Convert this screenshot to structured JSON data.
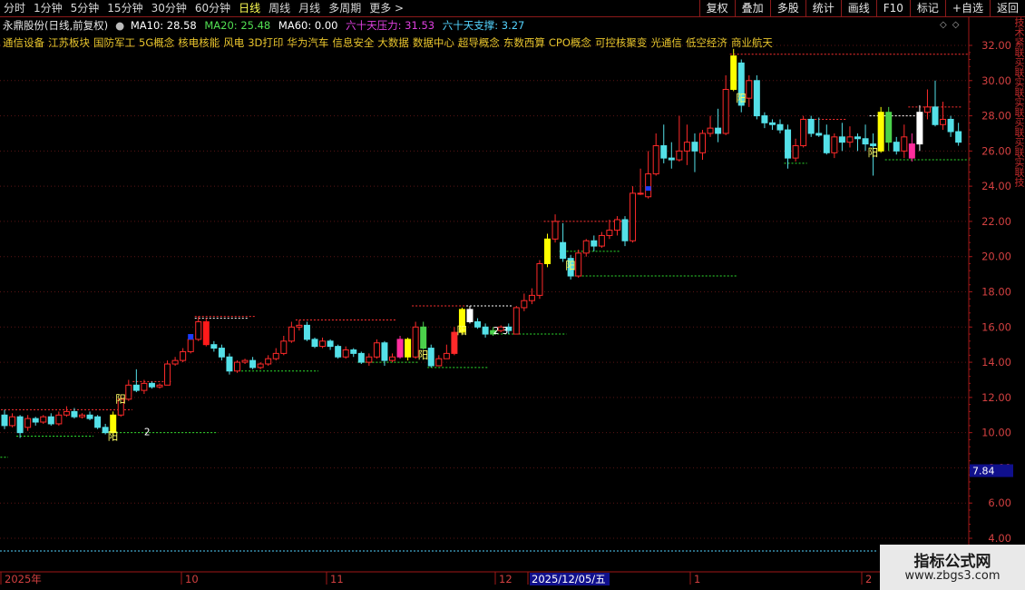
{
  "toolbar": {
    "periods": [
      "分时",
      "1分钟",
      "5分钟",
      "15分钟",
      "30分钟",
      "60分钟",
      "日线",
      "周线",
      "月线",
      "多周期",
      "更多 >"
    ],
    "active_period": "日线",
    "tools": [
      "复权",
      "叠加",
      "多股",
      "统计",
      "画线",
      "F10",
      "标记",
      "+自选",
      "返回"
    ]
  },
  "info": {
    "stock": "永鼎股份(日线,前复权)",
    "ma10": "MA10: 28.58",
    "ma20": "MA20: 25.48",
    "ma60": "MA60: 0.00",
    "pressure": "六十天压力: 31.53",
    "support": "六十天支撑: 3.27",
    "colors": {
      "ma10": "#ffffff",
      "ma20": "#52e052",
      "ma60": "#ffffff",
      "pressure": "#e040e0",
      "support": "#54d4ff",
      "concepts": "#e8c52d",
      "up": "#ff2a2a",
      "down": "#54e0e8"
    }
  },
  "concepts": [
    "通信设备",
    "江苏板块",
    "国防军工",
    "5G概念",
    "核电核能",
    "风电",
    "3D打印",
    "华为汽车",
    "信息安全",
    "大数据",
    "数据中心",
    "超导概念",
    "东数西算",
    "CPO概念",
    "可控核聚变",
    "光通信",
    "低空经济",
    "商业航天"
  ],
  "right_panel_text": "技术紧联买联实联实联买联买联实联技",
  "watermark": {
    "line1": "指标公式网",
    "line2": "www.zbgs3.com"
  },
  "chart_data": {
    "type": "candlestick",
    "y_axis": {
      "min": 4,
      "max": 32,
      "ticks": [
        "32.00",
        "30.00",
        "28.00",
        "26.00",
        "24.00",
        "22.00",
        "20.00",
        "18.00",
        "16.00",
        "14.00",
        "12.00",
        "10.00",
        "8.00",
        "6.00",
        "4.00"
      ]
    },
    "price_marker": "7.84",
    "x_labels": [
      "2025年",
      "10",
      "11",
      "12",
      "2025/12/05/五",
      "1",
      "2"
    ],
    "annotation": "阳",
    "annotations_extra": [
      "2",
      "2 3"
    ],
    "candles": [
      [
        11.0,
        10.4,
        11.3,
        10.2
      ],
      [
        10.4,
        10.9,
        11.1,
        10.3
      ],
      [
        10.9,
        10.0,
        11.0,
        9.7
      ],
      [
        10.3,
        10.8,
        11.0,
        10.1
      ],
      [
        10.8,
        10.6,
        10.9,
        10.4
      ],
      [
        10.6,
        10.9,
        11.0,
        10.5
      ],
      [
        10.9,
        10.5,
        11.1,
        10.4
      ],
      [
        10.5,
        11.0,
        11.2,
        10.4
      ],
      [
        11.0,
        11.2,
        11.5,
        10.9
      ],
      [
        11.2,
        10.9,
        11.4,
        10.8
      ],
      [
        10.9,
        11.0,
        11.1,
        10.8
      ],
      [
        11.0,
        10.8,
        11.2,
        10.7
      ],
      [
        10.9,
        10.3,
        11.0,
        10.2
      ],
      [
        10.3,
        10.0,
        10.5,
        9.9
      ],
      [
        10.0,
        11.0,
        11.2,
        9.8
      ],
      [
        11.0,
        11.9,
        12.1,
        10.9
      ],
      [
        11.9,
        12.7,
        13.0,
        11.8
      ],
      [
        12.7,
        12.4,
        13.6,
        12.3
      ],
      [
        12.4,
        12.8,
        13.0,
        12.2
      ],
      [
        12.8,
        12.6,
        12.9,
        12.5
      ],
      [
        12.6,
        12.7,
        12.8,
        12.5
      ],
      [
        12.7,
        13.9,
        14.1,
        12.7
      ],
      [
        13.9,
        14.1,
        14.3,
        13.8
      ],
      [
        14.1,
        14.6,
        14.8,
        14.0
      ],
      [
        14.6,
        15.3,
        15.6,
        14.5
      ],
      [
        15.3,
        16.3,
        16.6,
        15.2
      ],
      [
        16.3,
        15.0,
        16.5,
        14.9
      ],
      [
        15.0,
        14.8,
        15.2,
        14.6
      ],
      [
        14.8,
        14.3,
        15.0,
        14.1
      ],
      [
        14.3,
        13.5,
        14.5,
        13.3
      ],
      [
        13.5,
        14.0,
        14.1,
        13.4
      ],
      [
        14.0,
        14.1,
        14.2,
        13.9
      ],
      [
        14.1,
        13.7,
        14.3,
        13.6
      ],
      [
        13.7,
        13.9,
        14.0,
        13.6
      ],
      [
        13.9,
        14.2,
        14.4,
        13.8
      ],
      [
        14.2,
        14.5,
        14.8,
        14.1
      ],
      [
        14.5,
        15.2,
        15.5,
        14.4
      ],
      [
        15.2,
        16.0,
        16.3,
        15.1
      ],
      [
        16.0,
        16.1,
        16.4,
        15.8
      ],
      [
        16.1,
        15.3,
        16.3,
        15.2
      ],
      [
        15.3,
        14.9,
        15.4,
        14.8
      ],
      [
        14.9,
        15.2,
        15.4,
        14.8
      ],
      [
        15.2,
        14.9,
        15.3,
        14.7
      ],
      [
        14.9,
        14.3,
        15.0,
        14.2
      ],
      [
        14.3,
        14.7,
        14.9,
        14.2
      ],
      [
        14.7,
        14.5,
        14.8,
        14.3
      ],
      [
        14.5,
        14.0,
        14.6,
        13.9
      ],
      [
        14.0,
        14.3,
        14.5,
        13.8
      ],
      [
        14.3,
        15.1,
        15.3,
        14.2
      ],
      [
        15.1,
        14.1,
        15.2,
        13.8
      ],
      [
        14.1,
        14.3,
        14.5,
        14.0
      ],
      [
        14.3,
        15.3,
        15.5,
        14.2
      ],
      [
        15.3,
        14.3,
        15.4,
        14.1
      ],
      [
        14.3,
        16.0,
        16.3,
        14.2
      ],
      [
        16.0,
        14.8,
        16.3,
        14.7
      ],
      [
        14.8,
        13.8,
        15.0,
        13.7
      ],
      [
        13.8,
        14.2,
        14.4,
        13.9
      ],
      [
        14.2,
        14.5,
        15.0,
        14.3
      ],
      [
        14.5,
        15.7,
        16.0,
        14.4
      ],
      [
        15.7,
        17.0,
        17.1,
        15.6
      ],
      [
        17.0,
        16.3,
        17.2,
        16.2
      ],
      [
        16.3,
        16.0,
        16.5,
        15.9
      ],
      [
        16.0,
        15.6,
        16.2,
        15.4
      ],
      [
        15.6,
        15.8,
        16.0,
        15.5
      ],
      [
        15.8,
        16.0,
        16.1,
        15.7
      ],
      [
        16.0,
        15.8,
        16.2,
        15.6
      ],
      [
        15.6,
        17.1,
        17.2,
        15.6
      ],
      [
        17.1,
        17.5,
        17.9,
        16.9
      ],
      [
        17.5,
        17.8,
        18.2,
        17.3
      ],
      [
        17.8,
        19.6,
        19.8,
        17.6
      ],
      [
        19.6,
        21.0,
        21.3,
        19.4
      ],
      [
        21.0,
        22.0,
        22.4,
        20.8
      ],
      [
        20.8,
        19.9,
        21.9,
        19.7
      ],
      [
        19.9,
        18.9,
        20.1,
        18.7
      ],
      [
        18.9,
        20.2,
        20.4,
        18.8
      ],
      [
        20.2,
        20.9,
        21.0,
        20.0
      ],
      [
        20.9,
        20.6,
        21.2,
        20.3
      ],
      [
        20.6,
        21.2,
        21.4,
        20.5
      ],
      [
        21.2,
        21.5,
        22.1,
        21.0
      ],
      [
        21.5,
        22.1,
        22.3,
        21.2
      ],
      [
        22.1,
        20.9,
        22.3,
        20.6
      ],
      [
        20.9,
        23.6,
        24.0,
        20.8
      ],
      [
        23.6,
        23.6,
        25.0,
        23.5
      ],
      [
        23.4,
        24.7,
        26.0,
        23.3
      ],
      [
        24.7,
        26.3,
        27.0,
        24.6
      ],
      [
        26.3,
        25.6,
        27.5,
        25.3
      ],
      [
        25.6,
        25.5,
        26.5,
        25.0
      ],
      [
        25.5,
        26.0,
        28.0,
        25.4
      ],
      [
        26.0,
        26.5,
        27.5,
        25.2
      ],
      [
        26.5,
        26.0,
        27.0,
        24.8
      ],
      [
        25.9,
        27.0,
        27.2,
        25.5
      ],
      [
        27.0,
        27.3,
        28.0,
        26.8
      ],
      [
        27.3,
        27.0,
        28.4,
        26.5
      ],
      [
        27.0,
        29.5,
        30.3,
        26.9
      ],
      [
        29.5,
        31.4,
        31.8,
        29.4
      ],
      [
        31.0,
        28.6,
        31.2,
        28.2
      ],
      [
        29.0,
        30.0,
        30.3,
        28.5
      ],
      [
        30.0,
        28.0,
        30.3,
        27.8
      ],
      [
        28.0,
        27.6,
        28.2,
        27.3
      ],
      [
        27.6,
        27.5,
        27.8,
        27.2
      ],
      [
        27.5,
        27.2,
        27.8,
        27.0
      ],
      [
        27.2,
        25.6,
        27.5,
        25.0
      ],
      [
        25.6,
        26.3,
        26.7,
        25.4
      ],
      [
        26.3,
        27.8,
        28.0,
        26.2
      ],
      [
        27.8,
        27.0,
        28.0,
        26.8
      ],
      [
        27.0,
        26.9,
        27.9,
        26.8
      ],
      [
        26.9,
        25.9,
        27.5,
        25.8
      ],
      [
        25.9,
        26.8,
        27.0,
        25.6
      ],
      [
        26.8,
        26.5,
        27.6,
        26.0
      ],
      [
        26.5,
        26.8,
        27.4,
        26.2
      ],
      [
        26.8,
        26.7,
        27.0,
        26.0
      ],
      [
        26.7,
        26.4,
        27.5,
        26.0
      ],
      [
        26.4,
        26.3,
        27.0,
        24.6
      ],
      [
        26.0,
        28.2,
        28.5,
        25.9
      ],
      [
        28.2,
        26.5,
        28.5,
        26.0
      ],
      [
        26.5,
        26.0,
        26.8,
        25.8
      ],
      [
        26.0,
        26.8,
        27.5,
        25.6
      ],
      [
        25.6,
        26.4,
        27.0,
        25.4
      ],
      [
        26.4,
        28.2,
        28.6,
        26.0
      ],
      [
        28.2,
        28.5,
        29.5,
        27.8
      ],
      [
        28.5,
        27.5,
        30.0,
        27.4
      ],
      [
        27.5,
        27.8,
        28.8,
        27.2
      ],
      [
        27.8,
        27.1,
        28.0,
        26.8
      ],
      [
        27.1,
        26.5,
        27.6,
        26.3
      ]
    ],
    "pressure_segments": [
      {
        "from": 0,
        "to": 16,
        "y": 11.3
      },
      {
        "from": 17,
        "to": 21,
        "y": 12.9
      },
      {
        "from": 25,
        "to": 32,
        "y": 16.6
      },
      {
        "from": 38,
        "to": 50,
        "y": 16.4
      },
      {
        "from": 53,
        "to": 60,
        "y": 17.2
      },
      {
        "from": 70,
        "to": 81,
        "y": 22.0
      },
      {
        "from": 94,
        "to": 124,
        "y": 31.5
      },
      {
        "from": 104,
        "to": 108,
        "y": 27.8
      },
      {
        "from": 117,
        "to": 123,
        "y": 28.5
      }
    ],
    "support_segments": [
      {
        "from": -1,
        "to": 0,
        "y": 8.6
      },
      {
        "from": 2,
        "to": 11,
        "y": 9.8
      },
      {
        "from": 13,
        "to": 27,
        "y": 10.0
      },
      {
        "from": 31,
        "to": 40,
        "y": 13.5
      },
      {
        "from": 46,
        "to": 53,
        "y": 14.0
      },
      {
        "from": 55,
        "to": 62,
        "y": 13.7
      },
      {
        "from": 64,
        "to": 72,
        "y": 15.6
      },
      {
        "from": 72,
        "to": 79,
        "y": 20.3
      },
      {
        "from": 74,
        "to": 94,
        "y": 18.9
      },
      {
        "from": 101,
        "to": 103,
        "y": 25.3
      },
      {
        "from": 114,
        "to": 124,
        "y": 25.5
      }
    ],
    "highlight_candles": [
      {
        "i": 14,
        "color": "#ffff00"
      },
      {
        "i": 26,
        "color": "#ff1a1a"
      },
      {
        "i": 51,
        "color": "#ff2e9e"
      },
      {
        "i": 52,
        "color": "#ffff00"
      },
      {
        "i": 54,
        "color": "#4bd14b"
      },
      {
        "i": 58,
        "color": "#ff2a2a"
      },
      {
        "i": 59,
        "color": "#ffff00"
      },
      {
        "i": 70,
        "color": "#ffff00"
      },
      {
        "i": 94,
        "color": "#ffff00"
      },
      {
        "i": 113,
        "color": "#ffff00"
      },
      {
        "i": 114,
        "color": "#4bd14b"
      },
      {
        "i": 117,
        "color": "#ff2e9e"
      },
      {
        "i": 118,
        "color": "#ffffff"
      },
      {
        "i": 63,
        "color": "#4bd14b"
      },
      {
        "i": 60,
        "color": "#ffffff"
      }
    ]
  }
}
